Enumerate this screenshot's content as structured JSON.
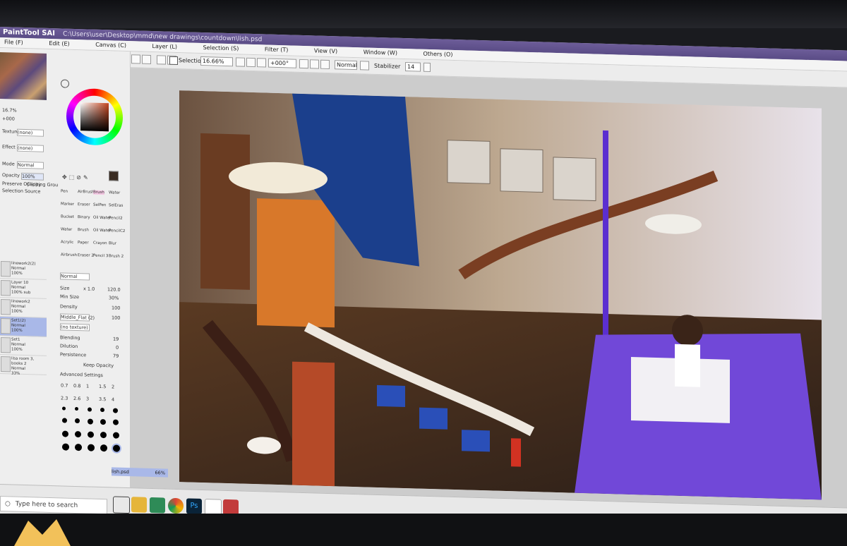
{
  "app": {
    "logo": "PaintTool SAI",
    "title_path": "C:\\Users\\user\\Desktop\\mmd\\new drawings\\countdown\\lish.psd"
  },
  "menu": [
    "File (F)",
    "Edit (E)",
    "Canvas (C)",
    "Layer (L)",
    "Selection (S)",
    "Filter (T)",
    "View (V)",
    "Window (W)",
    "Others (O)"
  ],
  "toolbar": {
    "selection_label": "Selection",
    "zoom": "16.66%",
    "rotation": "+000°",
    "blend_mode": "Normal",
    "stabilizer_label": "Stabilizer",
    "stabilizer_value": "14"
  },
  "left_panel": {
    "zoom_value": "16.7%",
    "angle_value": "+000",
    "texture_label": "Texture",
    "texture_value": "(none)",
    "effect_label": "Effect",
    "effect_value": "(none)",
    "mode_label": "Mode",
    "mode_value": "Normal",
    "opacity_label": "Opacity",
    "opacity_value": "100%",
    "preserve_opacity": "Preserve Opacity",
    "clipping_group": "Clipping Group",
    "selection_source": "Selection Source",
    "layers": [
      {
        "name": "linework2(2)",
        "mode": "Normal",
        "opacity": "100%",
        "selected": false
      },
      {
        "name": "Layer 10",
        "mode": "Normal",
        "opacity": "100% sub",
        "selected": false
      },
      {
        "name": "linework2",
        "mode": "Normal",
        "opacity": "100%",
        "selected": false
      },
      {
        "name": "Set1(2)",
        "mode": "Normal",
        "opacity": "100%",
        "selected": true
      },
      {
        "name": "Set1",
        "mode": "Normal",
        "opacity": "100%",
        "selected": false
      },
      {
        "name": "lisa room 3, books 2",
        "mode": "Normal",
        "opacity": "33%",
        "selected": false
      }
    ]
  },
  "tools": {
    "rows": [
      [
        "Pen",
        "AirBrush",
        "Brush",
        "Water"
      ],
      [
        "Marker",
        "Eraser",
        "SelPen",
        "SelEras"
      ],
      [
        "Bucket",
        "Binary",
        "Oil Water",
        "Pencil2"
      ],
      [
        "Water",
        "Brush",
        "Oil Water",
        "PencilC2"
      ],
      [
        "Acrylic",
        "Paper",
        "Crayon",
        "Blur"
      ],
      [
        "Airbrush",
        "Eraser 2",
        "Pencil 3",
        "Brush 2"
      ]
    ]
  },
  "brush_settings": {
    "mode_value": "Normal",
    "size_label": "Size",
    "size_mult": "x 1.0",
    "size_value": "120.0",
    "min_size_label": "Min Size",
    "min_size_value": "30%",
    "density_label": "Density",
    "density_value": "100",
    "shape_value": "Middle_Flat (2)",
    "shape_amount": "100",
    "texture_value": "(no texture)",
    "blending_label": "Blending",
    "blending_value": "19",
    "dilution_label": "Dilution",
    "dilution_value": "0",
    "persistence_label": "Persistence",
    "persistence_value": "79",
    "keep_opacity": "Keep Opacity",
    "advanced_settings": "Advanced Settings",
    "preset_sizes": [
      "0.7",
      "0.8",
      "1",
      "1.5",
      "2",
      "2.3",
      "2.6",
      "3",
      "3.5",
      "4"
    ]
  },
  "document_tab": {
    "name": "lish.psd",
    "zoom": "66%"
  },
  "taskbar": {
    "search_placeholder": "Type here to search"
  },
  "colors": {
    "titlebar": "#5a4c86",
    "selected_layer": "#a9b8e8",
    "canvas_bg": "#cccccc"
  }
}
